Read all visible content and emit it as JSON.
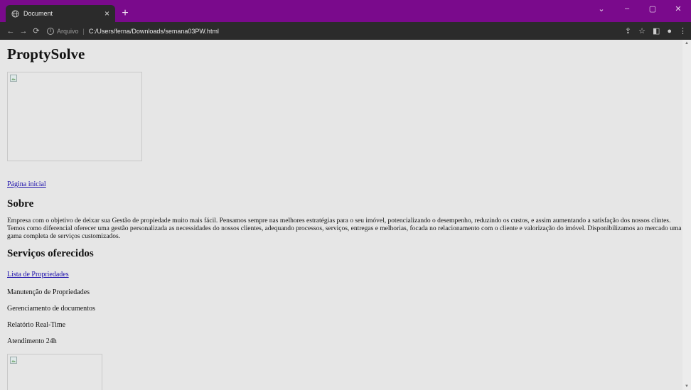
{
  "browser": {
    "tab_title": "Document",
    "tab_close": "×",
    "new_tab": "+",
    "scheme_label": "Arquivo",
    "url": "C:/Users/ferna/Downloads/semana03PW.html",
    "title_bar_color": "#7a0a8c"
  },
  "page": {
    "title": "ProptySolve",
    "home_link": "Página inicial",
    "about_heading": "Sobre",
    "about_text": "Empresa com o objetivo de deixar sua Gestão de propiedade muito mais fácil. Pensamos sempre nas melhores estratégias para o seu imóvel, potencializando o desempenho, reduzindo os custos, e assim aumentando a satisfação dos nossos clintes. Temos como diferencial oferecer uma gestão personalizada as necessidades do nossos clientes, adequando processos, serviços, entregas e melhorias, focada no relacionamento com o cliente e valorização do imóvel. Disponibilizamos ao mercado uma gama completa de serviços customizados.",
    "services_heading": "Serviços oferecidos",
    "services_link": "Lista de Propriedades",
    "services": [
      "Manutenção de Propriedades",
      "Gerenciamento de documentos",
      "Relatório Real-Time",
      "Atendimento 24h"
    ]
  }
}
